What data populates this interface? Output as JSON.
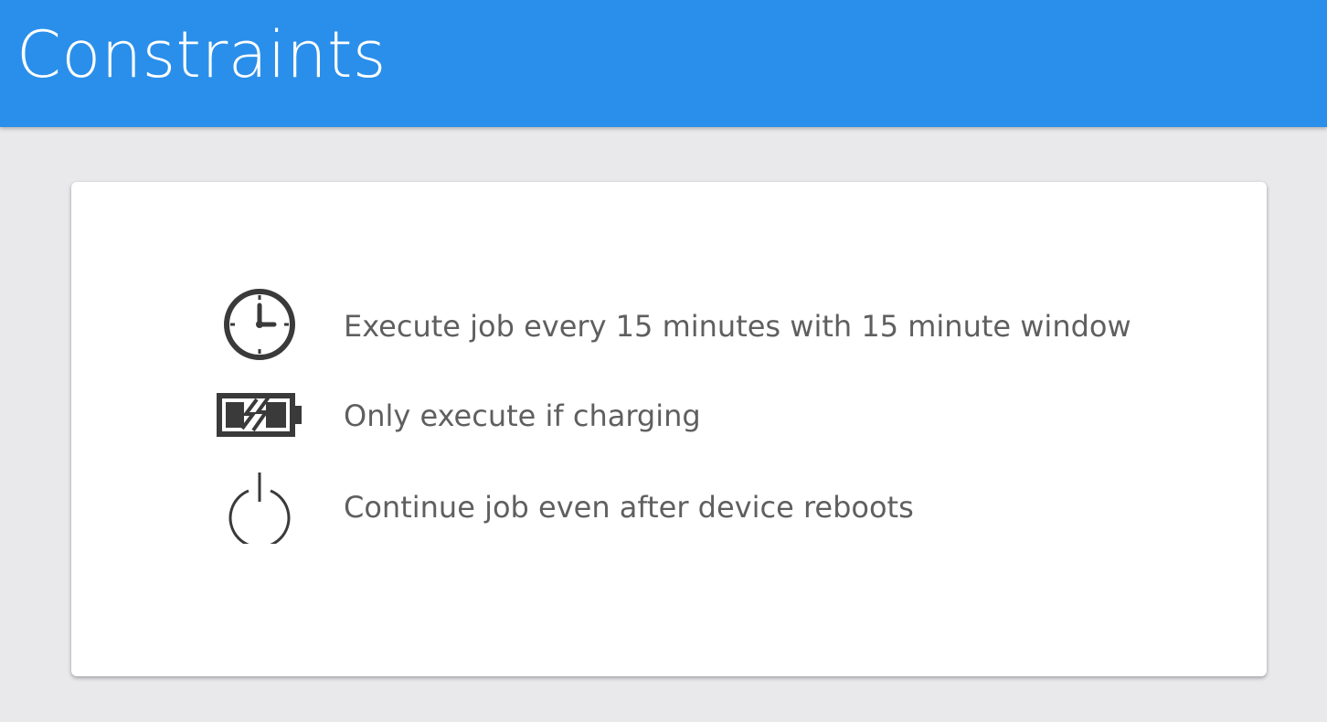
{
  "header": {
    "title": "Constraints",
    "background_color": "#2a8fea"
  },
  "card": {
    "items": [
      {
        "icon": "clock-icon",
        "label": "Execute job every 15 minutes with 15 minute window"
      },
      {
        "icon": "battery-charging-icon",
        "label": "Only execute if charging"
      },
      {
        "icon": "power-icon",
        "label": "Continue job even after device reboots"
      }
    ]
  },
  "colors": {
    "page_background": "#e9e8ea",
    "text": "#5f5f5f",
    "icon": "#3a3a3a"
  }
}
